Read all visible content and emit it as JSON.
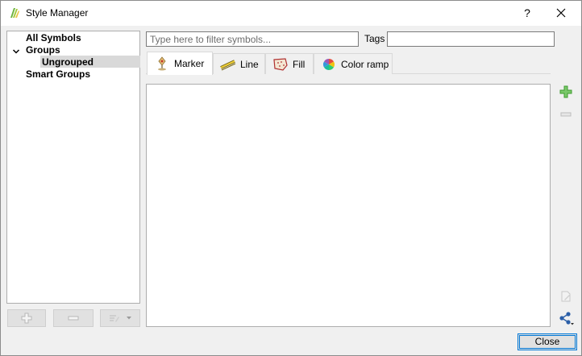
{
  "window": {
    "title": "Style Manager",
    "help_label": "?",
    "close_glyph": "✕"
  },
  "tree": {
    "items": [
      {
        "label": "All Symbols",
        "level": 0
      },
      {
        "label": "Groups",
        "level": 0,
        "expanded": true
      },
      {
        "label": "Ungrouped",
        "level": 1,
        "selected": true
      },
      {
        "label": "Smart Groups",
        "level": 0
      }
    ]
  },
  "filter": {
    "placeholder": "Type here to filter symbols...",
    "value": ""
  },
  "tags": {
    "label": "Tags",
    "value": ""
  },
  "tabs": [
    {
      "label": "Marker",
      "icon": "marker-icon",
      "active": true
    },
    {
      "label": "Line",
      "icon": "line-icon",
      "active": false
    },
    {
      "label": "Fill",
      "icon": "fill-icon",
      "active": false
    },
    {
      "label": "Color ramp",
      "icon": "color-ramp-icon",
      "active": false
    }
  ],
  "buttons": {
    "close_label": "Close"
  },
  "colors": {
    "add_green": "#3f9b2f",
    "accent_blue": "#0078d7",
    "share_blue": "#2b5fa8"
  }
}
